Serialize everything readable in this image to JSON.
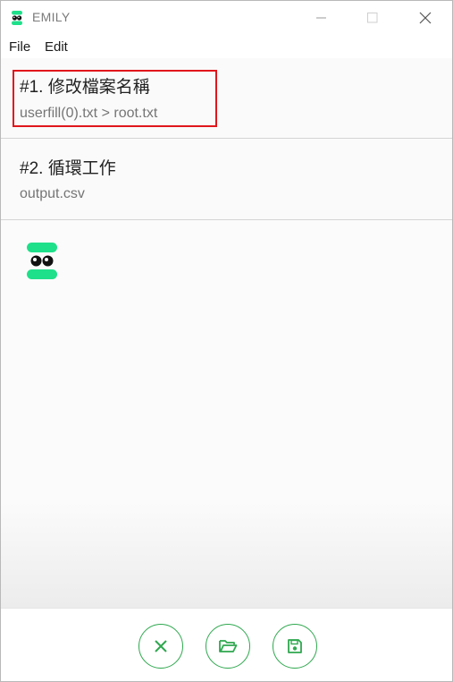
{
  "window": {
    "title": "EMILY"
  },
  "menu": {
    "file": "File",
    "edit": "Edit"
  },
  "tasks": [
    {
      "title": "#1. 修改檔案名稱",
      "subtitle": "userfill(0).txt > root.txt",
      "selected": true
    },
    {
      "title": "#2. 循環工作",
      "subtitle": "output.csv",
      "selected": false
    }
  ],
  "colors": {
    "accent": "#2fa84f",
    "mascot": "#1fe08a",
    "selection": "#e0161b"
  },
  "icons": {
    "cancel": "close-icon",
    "open": "folder-open-icon",
    "save": "save-icon"
  }
}
